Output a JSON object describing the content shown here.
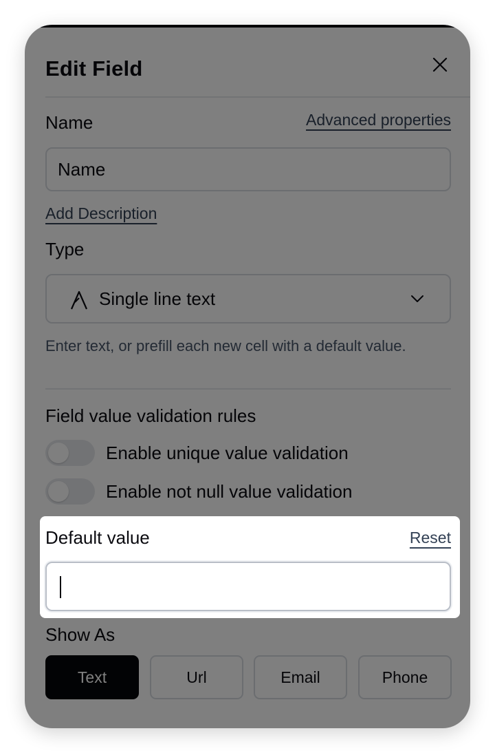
{
  "dialog": {
    "title": "Edit Field",
    "close_icon": "close-icon"
  },
  "name_section": {
    "label": "Name",
    "advanced_link": "Advanced properties",
    "value": "Name",
    "add_description_link": "Add Description"
  },
  "type_section": {
    "label": "Type",
    "type_icon": "text-type-icon",
    "selected": "Single line text",
    "chevron_icon": "chevron-down-icon",
    "helper": "Enter text, or prefill each new cell with a default value."
  },
  "validation": {
    "heading": "Field value validation rules",
    "rules": [
      {
        "label": "Enable unique value validation",
        "enabled": false
      },
      {
        "label": "Enable not null value validation",
        "enabled": false
      }
    ]
  },
  "default_value": {
    "label": "Default value",
    "reset_link": "Reset",
    "value": ""
  },
  "show_as": {
    "label": "Show As",
    "options": [
      "Text",
      "Url",
      "Email",
      "Phone"
    ],
    "selected": "Text"
  },
  "colors": {
    "overlay": "#000000",
    "active_button": "#05060a",
    "link": "#334155",
    "border": "#d7dbe1"
  }
}
